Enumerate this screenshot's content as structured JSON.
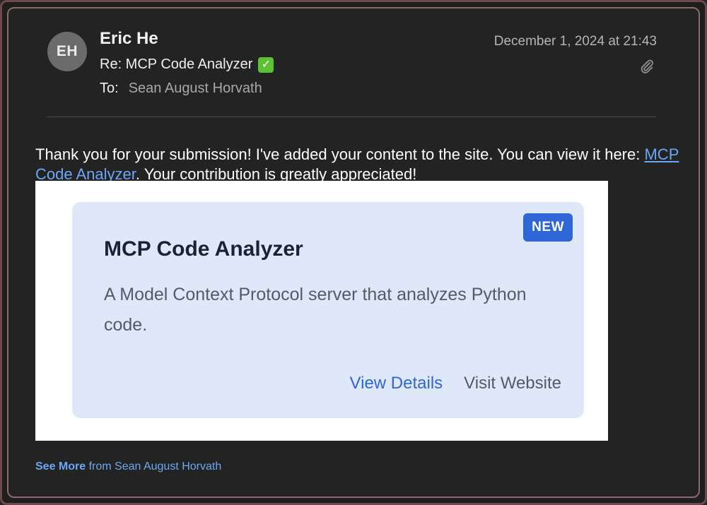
{
  "header": {
    "avatar_initials": "EH",
    "sender_name": "Eric He",
    "subject": "Re: MCP Code Analyzer",
    "subject_icon": "check-mark-button-emoji",
    "to_label": "To:",
    "to_value": "Sean August Horvath",
    "date": "December 1, 2024 at 21:43",
    "attachment_icon": "paperclip-icon"
  },
  "message": {
    "text_before_link": "Thank you for your submission! I've added your content to the site. You can view it here: ",
    "link_text": "MCP Code Analyzer",
    "text_after_link": ". Your contribution is greatly appreciated!"
  },
  "card": {
    "badge": "NEW",
    "title": "MCP Code Analyzer",
    "description": "A Model Context Protocol server that analyzes Python code.",
    "primary_action": "View Details",
    "secondary_action": "Visit Website"
  },
  "footer": {
    "see_more": "See More",
    "from_text": " from Sean August Horvath"
  },
  "colors": {
    "background": "#232323",
    "link": "#6aa8f5",
    "accent": "#2f66d6",
    "card_bg": "#dfe8f8",
    "check_green": "#5cc234"
  }
}
